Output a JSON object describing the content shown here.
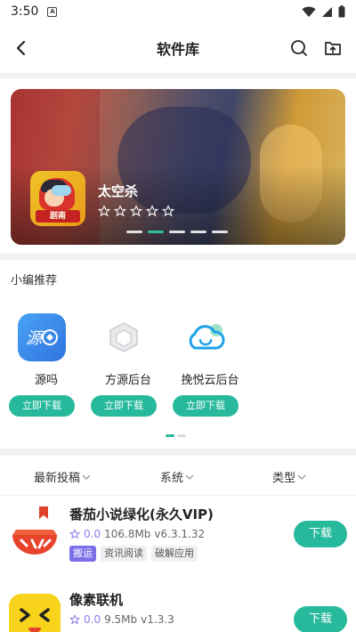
{
  "status": {
    "time": "3:50",
    "notification_glyph": "A"
  },
  "header": {
    "title": "软件库"
  },
  "banner": {
    "game_name": "太空杀",
    "game_icon_tag": "剧南",
    "stars": 0,
    "dots_count": 5,
    "active_dot": 1
  },
  "recommend": {
    "title": "小编推荐",
    "items": [
      {
        "name": "源吗",
        "button": "立即下载",
        "icon": "yuanma-app-icon",
        "icon_text": "源"
      },
      {
        "name": "方源后台",
        "button": "立即下载",
        "icon": "cube-app-icon"
      },
      {
        "name": "挽悦云后台",
        "button": "立即下载",
        "icon": "cloud-smile-app-icon"
      }
    ]
  },
  "filters": {
    "latest": "最新投稿",
    "system": "系统",
    "type": "类型"
  },
  "apps": [
    {
      "name": "番茄小说绿化(永久VIP)",
      "rating": "0.0",
      "size": "106.8Mb",
      "version": "v6.3.1.32",
      "tags": [
        "搬运",
        "资讯阅读",
        "破解应用"
      ],
      "button": "下载",
      "icon": "tomato-novel-icon"
    },
    {
      "name": "像素联机",
      "rating": "0.0",
      "size": "9.5Mb",
      "version": "v1.3.3",
      "tags": [],
      "button": "下载",
      "icon": "pixel-face-icon"
    }
  ],
  "colors": {
    "accent": "#27b99c",
    "tag_primary": "#7b6fe9",
    "rating": "#8a7fe8"
  }
}
